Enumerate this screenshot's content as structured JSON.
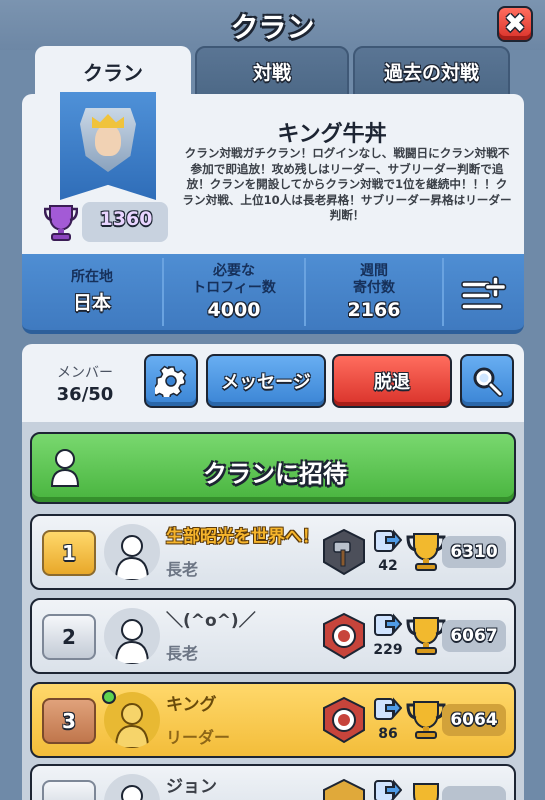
{
  "header": {
    "title": "クラン",
    "close_label": "✖"
  },
  "tabs": [
    {
      "label": "クラン",
      "active": true
    },
    {
      "label": "対戦",
      "active": false
    },
    {
      "label": "過去の対戦",
      "active": false
    }
  ],
  "clan": {
    "name": "キング牛丼",
    "description": "クラン対戦ガチクラン！ログインなし、戦闘日にクラン対戦不参加で即追放！攻め残しはリーダー、サブリーダー判断で追放！クランを開設してからクラン対戦で1位を継続中！！！クラン対戦、上位10人は長老昇格！サブリーダー昇格はリーダー判断！",
    "trophies": "1360"
  },
  "stats": {
    "location_label": "所在地",
    "location_value": "日本",
    "required_label": "必要な\nトロフィー数",
    "required_value": "4000",
    "weekly_label": "週間\n寄付数",
    "weekly_value": "2166"
  },
  "toolbar": {
    "members_label": "メンバー",
    "members_count": "36/50",
    "message_label": "メッセージ",
    "leave_label": "脱退"
  },
  "invite_label": "クランに招待",
  "members": [
    {
      "rank": "1",
      "name": "生部昭光を世界へ！",
      "role": "長老",
      "donations": "42",
      "trophies": "6310"
    },
    {
      "rank": "2",
      "name": "＼(^o^)／",
      "role": "長老",
      "donations": "229",
      "trophies": "6067"
    },
    {
      "rank": "3",
      "name": "キング",
      "role": "リーダー",
      "donations": "86",
      "trophies": "6064"
    },
    {
      "rank": "",
      "name": "ジョン",
      "role": "",
      "donations": "",
      "trophies": ""
    }
  ],
  "colors": {
    "blue_button": "#3a84d4",
    "red_button": "#d9322a",
    "green_button": "#48b43e",
    "self_row": "#f3bd3a"
  }
}
